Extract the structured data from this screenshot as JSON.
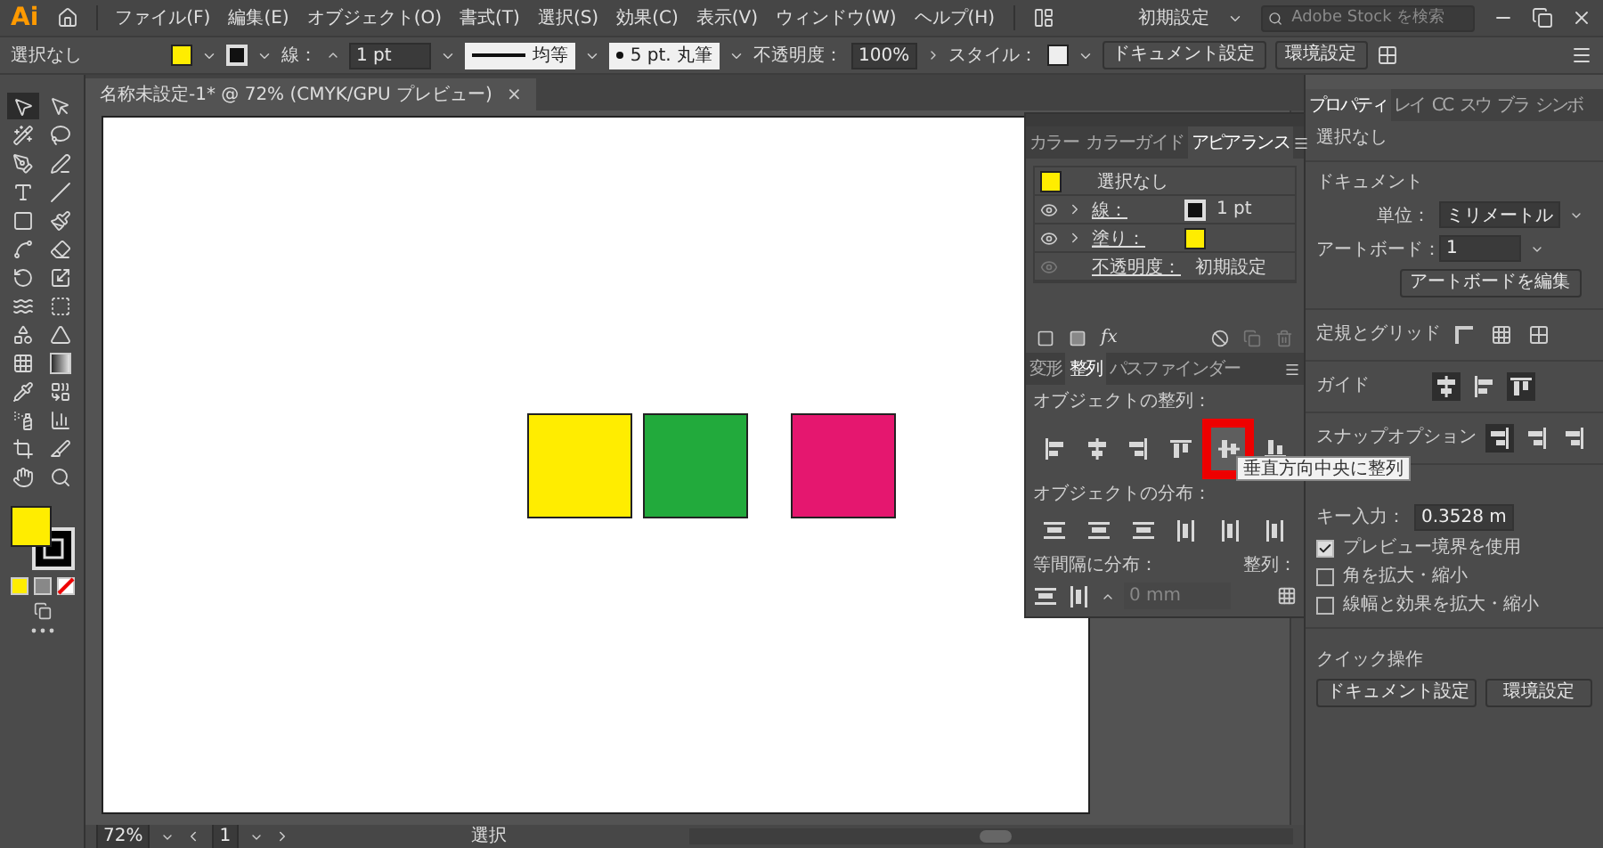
{
  "app": {
    "logo": "Ai",
    "menus": [
      "ファイル(F)",
      "編集(E)",
      "オブジェクト(O)",
      "書式(T)",
      "選択(S)",
      "効果(C)",
      "表示(V)",
      "ウィンドウ(W)",
      "ヘルプ(H)"
    ],
    "workspace": "初期設定",
    "search": {
      "placeholder": "Adobe Stock を検索"
    }
  },
  "control_bar": {
    "selection": "選択なし",
    "stroke_label": "線：",
    "stroke_weight": "1 pt",
    "stroke_profile": "均等",
    "brush": "5 pt. 丸筆",
    "opacity_label": "不透明度：",
    "opacity": "100%",
    "style_label": "スタイル：",
    "buttons": [
      "ドキュメント設定",
      "環境設定"
    ]
  },
  "document_tab": {
    "title": "名称未設定-1* @ 72% (CMYK/GPU プレビュー)",
    "close": "×"
  },
  "artboard": {
    "shapes": [
      {
        "color": "#ffed00"
      },
      {
        "color": "#22aa3c"
      },
      {
        "color": "#e5176f"
      }
    ]
  },
  "floating_panel": {
    "top_tabs": [
      {
        "label": "カラー",
        "selected": false
      },
      {
        "label": "カラーガイド",
        "selected": false
      },
      {
        "label": "アピアランス",
        "selected": true
      }
    ],
    "appearance": {
      "title": "選択なし",
      "rows": [
        {
          "kind": "stroke",
          "label": "線：",
          "value": "1 pt"
        },
        {
          "kind": "fill",
          "label": "塗り："
        },
        {
          "kind": "opacity",
          "label": "不透明度：",
          "value": "初期設定"
        }
      ]
    },
    "fx_label": "fx",
    "bottom_tabs": [
      {
        "label": "変形",
        "selected": false
      },
      {
        "label": "整列",
        "selected": true
      },
      {
        "label": "パスファインダー",
        "selected": false
      }
    ],
    "align_label": "オブジェクトの整列：",
    "align_buttons": [
      {
        "kind": "left",
        "highlighted": false
      },
      {
        "kind": "hcenter",
        "highlighted": false
      },
      {
        "kind": "right",
        "highlighted": false
      },
      {
        "kind": "top",
        "highlighted": false
      },
      {
        "kind": "vcenter",
        "highlighted": true
      },
      {
        "kind": "bottom",
        "highlighted": false
      }
    ],
    "tooltip": "垂直方向中央に整列",
    "distribute_label": "オブジェクトの分布：",
    "spacing_label": "等間隔に分布：",
    "spacing_value": "0 mm",
    "align_to_label": "整列："
  },
  "right_panel": {
    "tabs": [
      {
        "label": "プロパティ",
        "selected": true
      },
      {
        "label": "レイ",
        "selected": false
      },
      {
        "label": "CC",
        "selected": false
      },
      {
        "label": "スウ",
        "selected": false
      },
      {
        "label": "ブラ",
        "selected": false
      },
      {
        "label": "シンボ",
        "selected": false
      }
    ],
    "selection": "選択なし",
    "document_heading": "ドキュメント",
    "unit_label": "単位：",
    "unit": "ミリメートル",
    "artboard_label": "アートボード：",
    "artboard": "1",
    "edit_artboard": "アートボードを編集",
    "rulers_label": "定規とグリッド",
    "guides_label": "ガイド",
    "snap_label": "スナップオプション",
    "key_label": "キー入力：",
    "key_value": "0.3528 m",
    "checkboxes": [
      {
        "label": "プレビュー境界を使用",
        "checked": true
      },
      {
        "label": "角を拡大・縮小",
        "checked": false
      },
      {
        "label": "線幅と効果を拡大・縮小",
        "checked": false
      }
    ],
    "quick_heading": "クイック操作",
    "quick_buttons": [
      "ドキュメント設定",
      "環境設定"
    ]
  },
  "status_bar": {
    "zoom": "72%",
    "page": "1",
    "status": "選択"
  }
}
